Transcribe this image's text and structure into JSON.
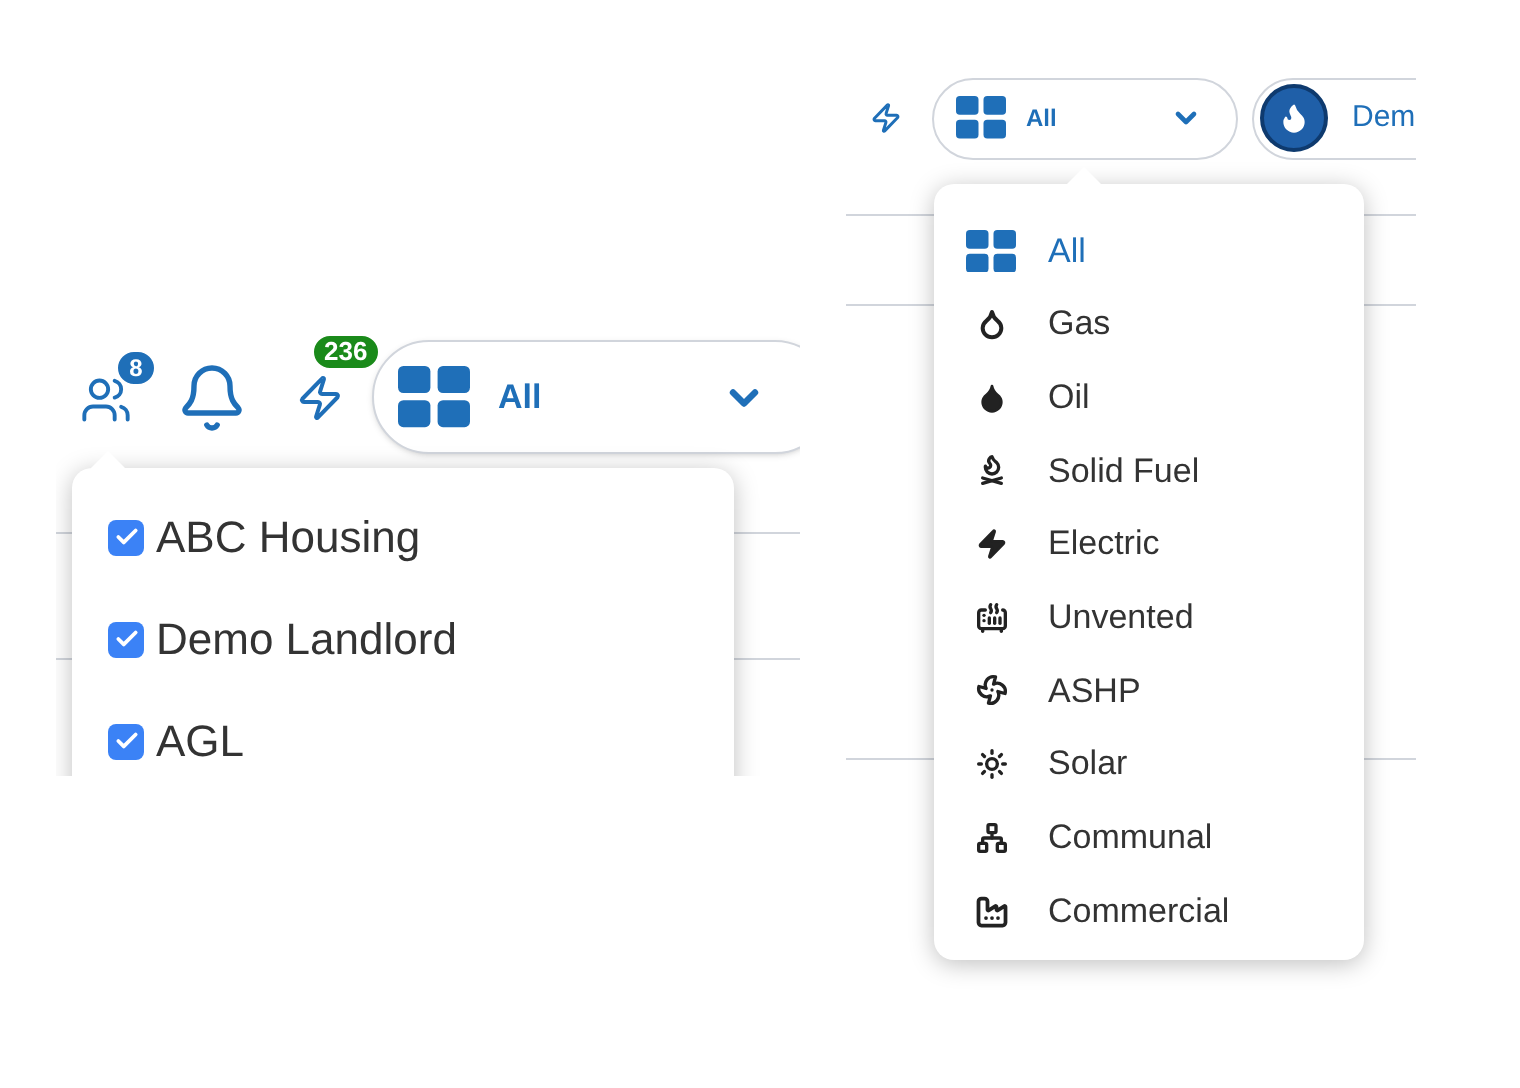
{
  "left_view": {
    "header": {
      "people_badge": "8",
      "alerts_badge": "236",
      "filter": {
        "label": "All"
      }
    },
    "organisations_menu": [
      {
        "label": "ABC Housing",
        "checked": true
      },
      {
        "label": "Demo Landlord",
        "checked": true
      },
      {
        "label": "AGL",
        "checked": true
      }
    ]
  },
  "right_view": {
    "header": {
      "filter": {
        "label": "All"
      },
      "account": {
        "label": "Dem"
      }
    },
    "fuel_menu": [
      {
        "label": "All",
        "selected": true
      },
      {
        "label": "Gas",
        "selected": false
      },
      {
        "label": "Oil",
        "selected": false
      },
      {
        "label": "Solid Fuel",
        "selected": false
      },
      {
        "label": "Electric",
        "selected": false
      },
      {
        "label": "Unvented",
        "selected": false
      },
      {
        "label": "ASHP",
        "selected": false
      },
      {
        "label": "Solar",
        "selected": false
      },
      {
        "label": "Communal",
        "selected": false
      },
      {
        "label": "Commercial",
        "selected": false
      }
    ]
  }
}
